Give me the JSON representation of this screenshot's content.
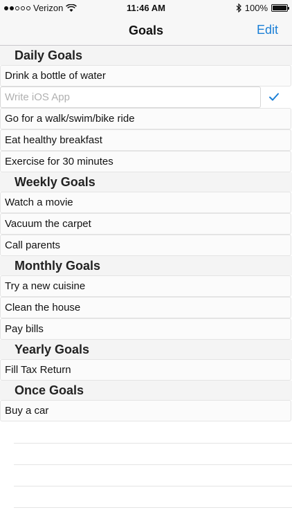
{
  "status_bar": {
    "carrier": "Verizon",
    "time": "11:46 AM",
    "battery": "100%",
    "battery_level": 1.0,
    "signal_bars_filled": 2,
    "signal_bars_total": 5
  },
  "nav": {
    "title": "Goals",
    "edit_label": "Edit"
  },
  "sections": [
    {
      "title": "Daily Goals",
      "items": [
        "Drink a bottle of water"
      ],
      "input_placeholder": "Write iOS App",
      "items_after": [
        "Go for a walk/swim/bike ride",
        "Eat healthy breakfast",
        "Exercise for 30 minutes"
      ]
    },
    {
      "title": "Weekly Goals",
      "items": [
        "Watch a movie",
        "Vacuum the carpet",
        "Call parents"
      ]
    },
    {
      "title": "Monthly Goals",
      "items": [
        "Try a new cuisine",
        "Clean the house",
        "Pay bills"
      ]
    },
    {
      "title": "Yearly Goals",
      "items": [
        "Fill Tax Return"
      ]
    },
    {
      "title": "Once Goals",
      "items": [
        "Buy a car"
      ]
    }
  ],
  "colors": {
    "accent": "#1a7fd6",
    "bar_background": "#f7f7f7",
    "section_background": "#f4f4f4"
  },
  "icons": {
    "wifi": "wifi-icon",
    "bluetooth": "bluetooth-icon",
    "checkmark": "checkmark-icon"
  }
}
